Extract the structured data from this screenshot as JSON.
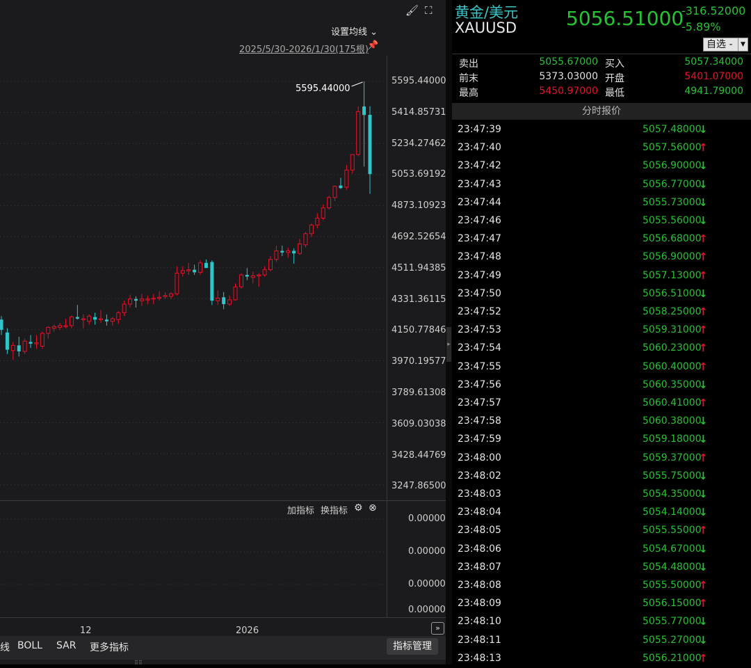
{
  "chart": {
    "ma_setting": "设置均线 ⌄",
    "range": "2025/5/30-2026/1/30(175根)",
    "high_annotation": "5595.44000",
    "price_axis": [
      "5595.44000",
      "5414.85731",
      "5234.27462",
      "5053.69192",
      "4873.10923",
      "4692.52654",
      "4511.94385",
      "4331.36115",
      "4150.77846",
      "3970.19577",
      "3789.61308",
      "3609.03038",
      "3428.44769",
      "3247.86500"
    ],
    "indicator": {
      "add_label": "加指标",
      "switch_label": "换指标",
      "values": [
        "0.00000",
        "0.00000",
        "0.00000",
        "0.00000"
      ]
    },
    "x_labels": [
      "12",
      "2026"
    ],
    "tabs": [
      "线",
      "BOLL",
      "SAR",
      "更多指标"
    ],
    "manage_label": "指标管理",
    "colors": {
      "up": "#e8102a",
      "down": "#2fc5c9"
    }
  },
  "chart_data": {
    "type": "candlestick",
    "ylim": [
      3247.865,
      5595.44
    ],
    "high": 5595.44,
    "candles": [
      {
        "o": 4210,
        "h": 4230,
        "l": 4120,
        "c": 4150
      },
      {
        "o": 4135,
        "h": 4160,
        "l": 4010,
        "c": 4035
      },
      {
        "o": 4030,
        "h": 4080,
        "l": 3975,
        "c": 4060
      },
      {
        "o": 4060,
        "h": 4110,
        "l": 3995,
        "c": 4025
      },
      {
        "o": 4025,
        "h": 4100,
        "l": 4010,
        "c": 4085
      },
      {
        "o": 4080,
        "h": 4120,
        "l": 4045,
        "c": 4070
      },
      {
        "o": 4070,
        "h": 4120,
        "l": 4040,
        "c": 4075
      },
      {
        "o": 4055,
        "h": 4140,
        "l": 4040,
        "c": 4130
      },
      {
        "o": 4130,
        "h": 4170,
        "l": 4100,
        "c": 4165
      },
      {
        "o": 4160,
        "h": 4180,
        "l": 4140,
        "c": 4170
      },
      {
        "o": 4165,
        "h": 4190,
        "l": 4150,
        "c": 4175
      },
      {
        "o": 4170,
        "h": 4215,
        "l": 4160,
        "c": 4175
      },
      {
        "o": 4175,
        "h": 4235,
        "l": 4160,
        "c": 4225
      },
      {
        "o": 4225,
        "h": 4295,
        "l": 4210,
        "c": 4215
      },
      {
        "o": 4215,
        "h": 4240,
        "l": 4160,
        "c": 4215
      },
      {
        "o": 4200,
        "h": 4240,
        "l": 4180,
        "c": 4230
      },
      {
        "o": 4225,
        "h": 4250,
        "l": 4180,
        "c": 4210
      },
      {
        "o": 4210,
        "h": 4265,
        "l": 4190,
        "c": 4215
      },
      {
        "o": 4210,
        "h": 4240,
        "l": 4175,
        "c": 4200
      },
      {
        "o": 4200,
        "h": 4225,
        "l": 4175,
        "c": 4215
      },
      {
        "o": 4210,
        "h": 4260,
        "l": 4185,
        "c": 4250
      },
      {
        "o": 4250,
        "h": 4320,
        "l": 4230,
        "c": 4300
      },
      {
        "o": 4300,
        "h": 4355,
        "l": 4280,
        "c": 4330
      },
      {
        "o": 4330,
        "h": 4345,
        "l": 4280,
        "c": 4320
      },
      {
        "o": 4320,
        "h": 4360,
        "l": 4290,
        "c": 4330
      },
      {
        "o": 4325,
        "h": 4350,
        "l": 4300,
        "c": 4330
      },
      {
        "o": 4330,
        "h": 4360,
        "l": 4300,
        "c": 4335
      },
      {
        "o": 4335,
        "h": 4375,
        "l": 4320,
        "c": 4340
      },
      {
        "o": 4345,
        "h": 4370,
        "l": 4330,
        "c": 4350
      },
      {
        "o": 4345,
        "h": 4370,
        "l": 4330,
        "c": 4360
      },
      {
        "o": 4360,
        "h": 4520,
        "l": 4350,
        "c": 4480
      },
      {
        "o": 4480,
        "h": 4520,
        "l": 4460,
        "c": 4495
      },
      {
        "o": 4495,
        "h": 4540,
        "l": 4470,
        "c": 4500
      },
      {
        "o": 4500,
        "h": 4530,
        "l": 4470,
        "c": 4485
      },
      {
        "o": 4485,
        "h": 4555,
        "l": 4470,
        "c": 4540
      },
      {
        "o": 4540,
        "h": 4560,
        "l": 4520,
        "c": 4510
      },
      {
        "o": 4545,
        "h": 4555,
        "l": 4295,
        "c": 4320
      },
      {
        "o": 4320,
        "h": 4380,
        "l": 4295,
        "c": 4335
      },
      {
        "o": 4340,
        "h": 4370,
        "l": 4270,
        "c": 4300
      },
      {
        "o": 4300,
        "h": 4350,
        "l": 4290,
        "c": 4325
      },
      {
        "o": 4325,
        "h": 4420,
        "l": 4320,
        "c": 4400
      },
      {
        "o": 4400,
        "h": 4480,
        "l": 4390,
        "c": 4470
      },
      {
        "o": 4470,
        "h": 4510,
        "l": 4440,
        "c": 4460
      },
      {
        "o": 4455,
        "h": 4490,
        "l": 4420,
        "c": 4465
      },
      {
        "o": 4465,
        "h": 4480,
        "l": 4400,
        "c": 4470
      },
      {
        "o": 4470,
        "h": 4520,
        "l": 4460,
        "c": 4500
      },
      {
        "o": 4500,
        "h": 4580,
        "l": 4490,
        "c": 4560
      },
      {
        "o": 4560,
        "h": 4640,
        "l": 4545,
        "c": 4610
      },
      {
        "o": 4610,
        "h": 4640,
        "l": 4580,
        "c": 4600
      },
      {
        "o": 4600,
        "h": 4630,
        "l": 4570,
        "c": 4610
      },
      {
        "o": 4610,
        "h": 4625,
        "l": 4535,
        "c": 4595
      },
      {
        "o": 4595,
        "h": 4680,
        "l": 4585,
        "c": 4650
      },
      {
        "o": 4645,
        "h": 4720,
        "l": 4630,
        "c": 4710
      },
      {
        "o": 4710,
        "h": 4770,
        "l": 4690,
        "c": 4760
      },
      {
        "o": 4760,
        "h": 4830,
        "l": 4740,
        "c": 4800
      },
      {
        "o": 4800,
        "h": 4880,
        "l": 4790,
        "c": 4860
      },
      {
        "o": 4860,
        "h": 4930,
        "l": 4850,
        "c": 4920
      },
      {
        "o": 4920,
        "h": 4990,
        "l": 4900,
        "c": 4985
      },
      {
        "o": 4990,
        "h": 5035,
        "l": 4970,
        "c": 4975
      },
      {
        "o": 4980,
        "h": 5110,
        "l": 4965,
        "c": 5080
      },
      {
        "o": 5080,
        "h": 5160,
        "l": 5060,
        "c": 5170
      },
      {
        "o": 5170,
        "h": 5450,
        "l": 5160,
        "c": 5420
      },
      {
        "o": 5450,
        "h": 5595.44,
        "l": 5100,
        "c": 5400
      },
      {
        "o": 5401.07,
        "h": 5450.97,
        "l": 4941.79,
        "c": 5056.51
      }
    ]
  },
  "quote": {
    "name_cn": "黄金/美元",
    "symbol": "XAUUSD",
    "price": "5056.51000",
    "change": "-316.52000",
    "change_pct": "-5.89%",
    "watch_label": "自选 -",
    "stats": [
      {
        "label": "卖出",
        "value": "5055.67000",
        "color": "#26c233"
      },
      {
        "label": "买入",
        "value": "5057.34000",
        "color": "#26c233"
      },
      {
        "label": "前末",
        "value": "5373.03000",
        "color": "#e0e0e0"
      },
      {
        "label": "开盘",
        "value": "5401.07000",
        "color": "#e8102a"
      },
      {
        "label": "最高",
        "value": "5450.97000",
        "color": "#e8102a"
      },
      {
        "label": "最低",
        "value": "4941.79000",
        "color": "#26c233"
      }
    ],
    "ticks_title": "分时报价",
    "ticks": [
      {
        "time": "23:47:39",
        "price": "5057.48000",
        "dir": "down"
      },
      {
        "time": "23:47:40",
        "price": "5057.56000",
        "dir": "up"
      },
      {
        "time": "23:47:42",
        "price": "5056.90000",
        "dir": "down"
      },
      {
        "time": "23:47:43",
        "price": "5056.77000",
        "dir": "down"
      },
      {
        "time": "23:47:44",
        "price": "5055.73000",
        "dir": "down"
      },
      {
        "time": "23:47:46",
        "price": "5055.56000",
        "dir": "down"
      },
      {
        "time": "23:47:47",
        "price": "5056.68000",
        "dir": "up"
      },
      {
        "time": "23:47:48",
        "price": "5056.90000",
        "dir": "up"
      },
      {
        "time": "23:47:49",
        "price": "5057.13000",
        "dir": "up"
      },
      {
        "time": "23:47:50",
        "price": "5056.51000",
        "dir": "down"
      },
      {
        "time": "23:47:52",
        "price": "5058.25000",
        "dir": "up"
      },
      {
        "time": "23:47:53",
        "price": "5059.31000",
        "dir": "up"
      },
      {
        "time": "23:47:54",
        "price": "5060.23000",
        "dir": "up"
      },
      {
        "time": "23:47:55",
        "price": "5060.40000",
        "dir": "up"
      },
      {
        "time": "23:47:56",
        "price": "5060.35000",
        "dir": "down"
      },
      {
        "time": "23:47:57",
        "price": "5060.41000",
        "dir": "up"
      },
      {
        "time": "23:47:58",
        "price": "5060.38000",
        "dir": "down"
      },
      {
        "time": "23:47:59",
        "price": "5059.18000",
        "dir": "down"
      },
      {
        "time": "23:48:00",
        "price": "5059.37000",
        "dir": "up"
      },
      {
        "time": "23:48:02",
        "price": "5055.75000",
        "dir": "down"
      },
      {
        "time": "23:48:03",
        "price": "5054.35000",
        "dir": "down"
      },
      {
        "time": "23:48:04",
        "price": "5054.14000",
        "dir": "down"
      },
      {
        "time": "23:48:05",
        "price": "5055.55000",
        "dir": "up"
      },
      {
        "time": "23:48:06",
        "price": "5054.67000",
        "dir": "down"
      },
      {
        "time": "23:48:07",
        "price": "5054.48000",
        "dir": "down"
      },
      {
        "time": "23:48:08",
        "price": "5055.50000",
        "dir": "up"
      },
      {
        "time": "23:48:09",
        "price": "5056.15000",
        "dir": "up"
      },
      {
        "time": "23:48:10",
        "price": "5055.77000",
        "dir": "down"
      },
      {
        "time": "23:48:11",
        "price": "5055.27000",
        "dir": "down"
      },
      {
        "time": "23:48:13",
        "price": "5056.21000",
        "dir": "up"
      }
    ]
  }
}
